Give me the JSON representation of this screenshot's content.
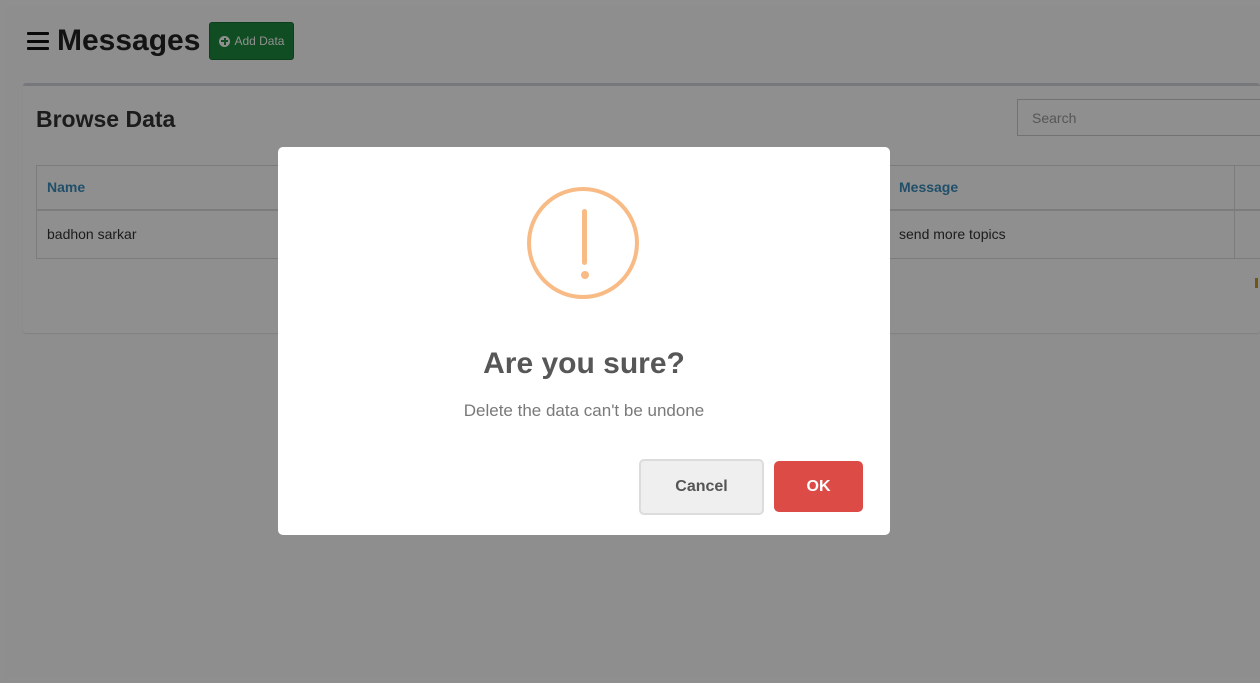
{
  "header": {
    "title": "Messages",
    "add_button_label": "Add Data"
  },
  "panel": {
    "title": "Browse Data",
    "search_placeholder": "Search"
  },
  "table": {
    "columns": [
      "Name",
      "Message",
      ""
    ],
    "rows": [
      {
        "name": "badhon sarkar",
        "message": "send more topics"
      }
    ]
  },
  "dialog": {
    "icon": "warning-icon",
    "title": "Are you sure?",
    "text": "Delete the data can't be undone",
    "cancel_label": "Cancel",
    "ok_label": "OK"
  },
  "colors": {
    "add_button": "#1e8a3e",
    "link_header": "#3c8dbc",
    "warning": "#f8bb86",
    "ok_button": "#dd4b47"
  }
}
